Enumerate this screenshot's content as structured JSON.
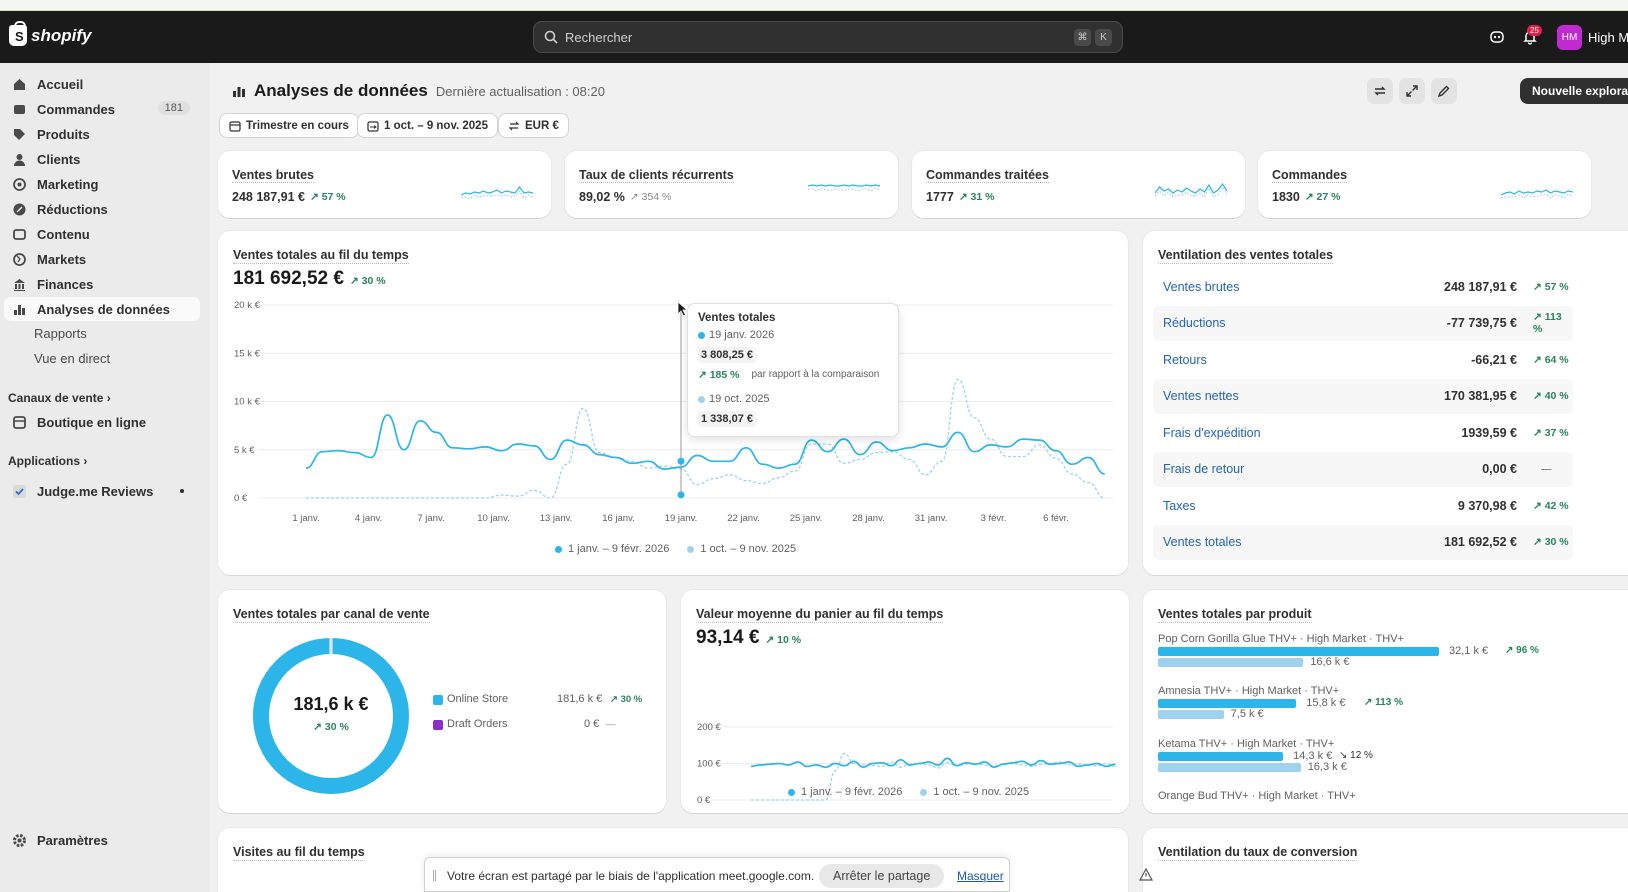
{
  "app": {
    "brand": "shopify",
    "search_placeholder": "Rechercher",
    "kbd1": "⌘",
    "kbd2": "K",
    "badge": "25",
    "avatar": "HM",
    "store": "High Ma"
  },
  "sidebar": {
    "items": [
      {
        "label": "Accueil",
        "icon": "home-icon"
      },
      {
        "label": "Commandes",
        "icon": "inbox-icon",
        "count": "181"
      },
      {
        "label": "Produits",
        "icon": "tag-icon"
      },
      {
        "label": "Clients",
        "icon": "person-icon"
      },
      {
        "label": "Marketing",
        "icon": "target-icon"
      },
      {
        "label": "Réductions",
        "icon": "discount-icon"
      },
      {
        "label": "Contenu",
        "icon": "content-icon"
      },
      {
        "label": "Markets",
        "icon": "globe-icon"
      },
      {
        "label": "Finances",
        "icon": "bank-icon"
      },
      {
        "label": "Analyses de données",
        "icon": "chart-icon"
      },
      {
        "label": "Rapports"
      },
      {
        "label": "Vue en direct"
      }
    ],
    "channels_title": "Canaux de vente",
    "online_store": "Boutique en ligne",
    "apps_title": "Applications",
    "judgeme": "Judge.me Reviews",
    "settings": "Paramètres"
  },
  "header": {
    "title": "Analyses de données",
    "updated": "Dernière actualisation : 08:20",
    "new_btn": "Nouvelle exploration"
  },
  "filters": {
    "period": "Trimestre en cours",
    "compare": "1 oct. – 9 nov. 2025",
    "currency": "EUR €"
  },
  "kpis": [
    {
      "title": "Ventes brutes",
      "value": "248 187,91 €",
      "change": "↗ 57 %"
    },
    {
      "title": "Taux de clients récurrents",
      "value": "89,02 %",
      "change": "↗ 354 %"
    },
    {
      "title": "Commandes traitées",
      "value": "1777",
      "change": "↗ 31 %"
    },
    {
      "title": "Commandes",
      "value": "1830",
      "change": "↗ 27 %"
    }
  ],
  "sales_chart": {
    "title": "Ventes totales au fil du temps",
    "value": "181 692,52 €",
    "change": "↗ 30 %",
    "legend_current": "1 janv. – 9 févr. 2026",
    "legend_prev": "1 oct. – 9 nov. 2025",
    "tooltip": {
      "title": "Ventes totales",
      "date1": "19 janv. 2026",
      "value1": "3 808,25 €",
      "change": "↗ 185 %",
      "change_label": "par rapport à la comparaison",
      "date2": "19 oct. 2025",
      "value2": "1 338,07 €"
    }
  },
  "chart_data": [
    {
      "type": "line",
      "title": "Ventes totales au fil du temps",
      "yticks": [
        "20 k €",
        "15 k €",
        "10 k €",
        "5 k €",
        "0 €"
      ],
      "ylim": [
        0,
        20000
      ],
      "xticks": [
        "1 janv.",
        "4 janv.",
        "7 janv.",
        "10 janv.",
        "13 janv.",
        "16 janv.",
        "19 janv.",
        "22 janv.",
        "25 janv.",
        "28 janv.",
        "31 janv.",
        "3 févr.",
        "6 févr."
      ],
      "series": [
        {
          "name": "1 janv. – 9 févr. 2026",
          "color": "#2bb5e8",
          "values": [
            3100,
            4800,
            4900,
            4700,
            4200,
            8600,
            5000,
            8000,
            6800,
            5200,
            5100,
            5300,
            4900,
            5600,
            5400,
            4000,
            6000,
            5500,
            4500,
            4200,
            3600,
            3800,
            3000,
            3200,
            4400,
            3800,
            3800,
            5200,
            3500,
            3100,
            3500,
            6000,
            4800,
            6100,
            4500,
            5800,
            4900,
            5200,
            5600,
            5300,
            6800,
            4800,
            5500,
            5300,
            6100,
            6000,
            4900,
            3500,
            4200,
            2500
          ]
        },
        {
          "name": "1 oct. – 9 nov. 2025",
          "color": "#9fd2ef",
          "values": [
            0,
            0,
            0,
            0,
            0,
            0,
            0,
            0,
            0,
            0,
            0,
            0,
            300,
            200,
            800,
            0,
            3500,
            9300,
            4700,
            4200,
            3800,
            3100,
            3300,
            3000,
            1400,
            2000,
            2400,
            1800,
            1500,
            2100,
            2800,
            5600,
            5600,
            3600,
            4000,
            4700,
            4800,
            4000,
            2400,
            3800,
            12300,
            8300,
            6100,
            4300,
            4300,
            5500,
            4100,
            2500,
            1600,
            0
          ]
        }
      ]
    },
    {
      "type": "pie",
      "title": "Ventes totales par canal de vente",
      "center": "181,6 k €",
      "center_change": "↗ 30 %",
      "categories": [
        "Online Store",
        "Draft Orders"
      ],
      "values": [
        181600,
        0
      ],
      "labels": [
        "181,6 k €",
        "0 €"
      ],
      "changes": [
        "↗ 30 %",
        "—"
      ],
      "colors": [
        "#2bb5e8",
        "#8b2fc9"
      ]
    },
    {
      "type": "line",
      "title": "Valeur moyenne du panier au fil du temps",
      "yticks": [
        "200 €",
        "100 €",
        "0 €"
      ],
      "ylim": [
        0,
        200
      ],
      "xticks": [
        "1 janv.",
        "7 janv.",
        "13 janv.",
        "19 janv.",
        "25 janv.",
        "31 janv.",
        "6 févr."
      ],
      "series": [
        {
          "name": "1 janv. – 9 févr. 2026",
          "color": "#2bb5e8",
          "values": [
            92,
            96,
            98,
            100,
            96,
            104,
            92,
            96,
            90,
            100,
            94,
            106,
            90,
            100,
            102,
            94,
            110,
            96,
            100,
            104,
            96,
            114,
            94,
            102,
            98,
            104,
            90,
            98,
            102,
            106,
            96,
            108,
            98,
            100,
            104,
            92,
            96,
            100,
            92,
            98
          ]
        },
        {
          "name": "1 oct. – 9 nov. 2025",
          "color": "#9fd2ef",
          "values": [
            0,
            0,
            0,
            0,
            0,
            0,
            0,
            0,
            0,
            80,
            128,
            100,
            96,
            94,
            92,
            104,
            90,
            98,
            100,
            96,
            88,
            102,
            94,
            98,
            100,
            96,
            94,
            98,
            100,
            96,
            92,
            98,
            100,
            104,
            96,
            98,
            96,
            94,
            100,
            92
          ]
        }
      ]
    },
    {
      "type": "bar",
      "title": "Ventes totales par produit",
      "categories": [
        "Pop Corn Gorilla Glue THV+ · High Market · THV+",
        "Amnesia THV+ · High Market · THV+",
        "Ketama THV+ · High Market · THV+",
        "Orange Bud THV+ · High Market · THV+"
      ],
      "series": [
        {
          "name": "1 janv. – 9 févr. 2026",
          "values": [
            32100,
            15800,
            14300
          ]
        },
        {
          "name": "1 oct. – 9 nov. 2025",
          "values": [
            16600,
            7500,
            16300
          ]
        }
      ],
      "labels_current": [
        "32,1 k €",
        "15,8 k €",
        "14,3 k €"
      ],
      "labels_prev": [
        "16,6 k €",
        "7,5 k €",
        "16,3 k €"
      ],
      "changes": [
        "↗ 96 %",
        "↗ 113 %",
        "↘ 12 %"
      ]
    }
  ],
  "breakdown": {
    "title": "Ventilation des ventes totales",
    "rows": [
      {
        "label": "Ventes brutes",
        "value": "248 187,91 €",
        "change": "↗ 57 %"
      },
      {
        "label": "Réductions",
        "value": "-77 739,75 €",
        "change": "↗ 113 %"
      },
      {
        "label": "Retours",
        "value": "-66,21 €",
        "change": "↗ 64 %"
      },
      {
        "label": "Ventes nettes",
        "value": "170 381,95 €",
        "change": "↗ 40 %"
      },
      {
        "label": "Frais d'expédition",
        "value": "1939,59 €",
        "change": "↗ 37 %"
      },
      {
        "label": "Frais de retour",
        "value": "0,00 €",
        "change": "—"
      },
      {
        "label": "Taxes",
        "value": "9 370,98 €",
        "change": "↗ 42 %"
      },
      {
        "label": "Ventes totales",
        "value": "181 692,52 €",
        "change": "↗ 30 %"
      }
    ]
  },
  "aov": {
    "value": "93,14 €",
    "change": "↗ 10 %",
    "legend_current": "1 janv. – 9 févr. 2026",
    "legend_prev": "1 oct. – 9 nov. 2025"
  },
  "bottom": {
    "visits_title": "Visites au fil du temps",
    "conversion_title": "Ventilation du taux de conversion"
  },
  "share": {
    "text": "Votre écran est partagé par le biais de l'application meet.google.com.",
    "stop": "Arrêter le partage",
    "hide": "Masquer"
  },
  "colors": {
    "accent": "#2bb5e8",
    "accent_light": "#9fd2ef",
    "positive": "#29845a",
    "link": "#2463bc"
  }
}
